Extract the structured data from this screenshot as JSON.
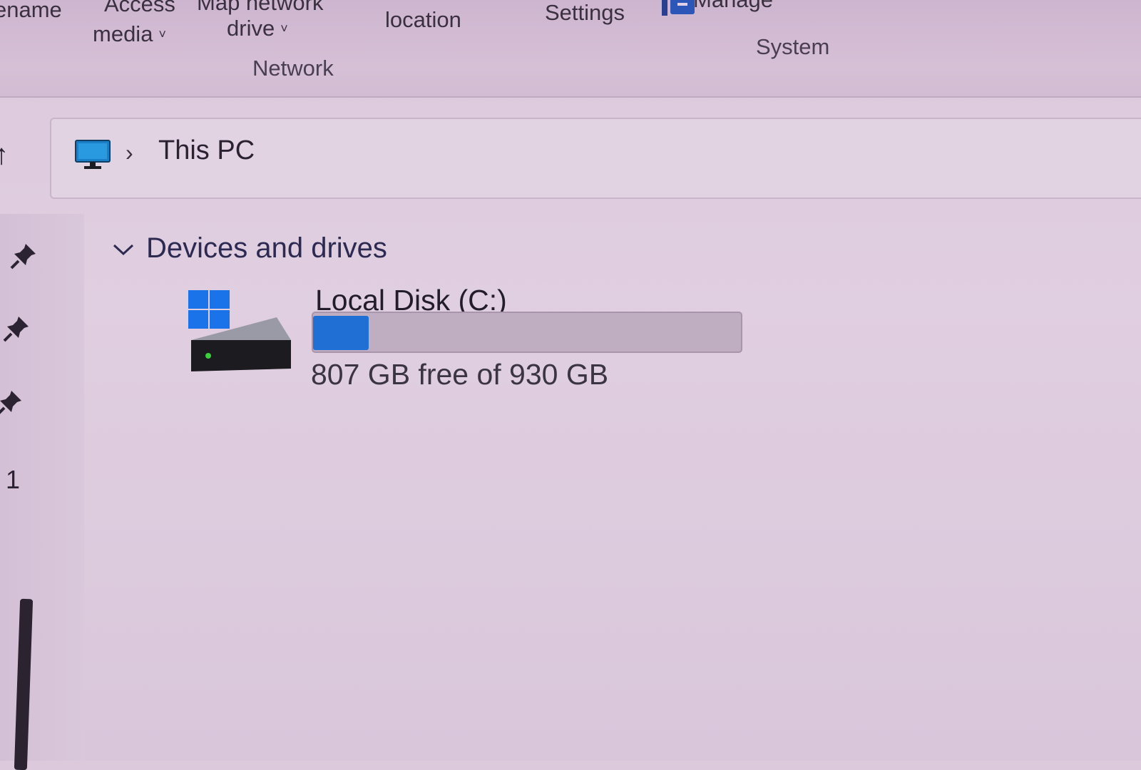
{
  "ribbon": {
    "rename_label": "ename",
    "access_media_top": "Access",
    "access_media_bottom": "media",
    "map_drive_top": "Map network",
    "map_drive_bottom": "drive",
    "add_location_label": "location",
    "settings_label": "Settings",
    "manage_label": "Manage",
    "network_group": "Network",
    "system_group": "System",
    "dropdown_glyph": "˅"
  },
  "address": {
    "up_glyph": "↑",
    "separator": "›",
    "crumb": "This PC"
  },
  "nav": {
    "visible_number": "1"
  },
  "content": {
    "section_title": "Devices and drives",
    "drive": {
      "name": "Local Disk (C:)",
      "space_text": "807 GB free of 930 GB",
      "used_fraction": 0.13
    }
  },
  "colors": {
    "accent_blue": "#1f6fd4",
    "windows_logo": "#1a73e8"
  },
  "icons": {
    "up": "up-arrow-icon",
    "pc": "monitor-icon",
    "pin": "pin-icon",
    "section": "chevron-down-icon",
    "drive": "hard-drive-windows-icon",
    "manage": "briefcase-icon"
  }
}
